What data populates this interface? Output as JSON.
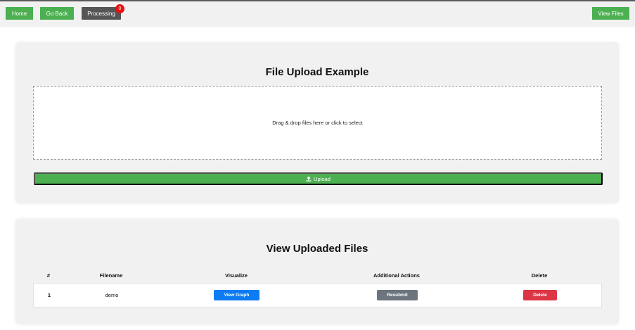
{
  "nav": {
    "home": "Home",
    "go_back": "Go Back",
    "processing": "Processing",
    "processing_count": "0",
    "view_files": "View Files"
  },
  "upload": {
    "title": "File Upload Example",
    "dropzone_text": "Drag & drop files here or click to select",
    "upload_label": "Upload",
    "upload_icon": "upload-icon"
  },
  "files": {
    "title": "View Uploaded Files",
    "columns": [
      "#",
      "Filename",
      "Visualize",
      "Additional Actions",
      "Delete"
    ],
    "rows": [
      {
        "index": "1",
        "filename": "demo",
        "visualize_label": "View Graph",
        "action_label": "Resubmit",
        "delete_label": "Delete"
      }
    ]
  },
  "colors": {
    "green": "#4caf50",
    "dark": "#555555",
    "badge": "#e81010",
    "blue": "#0d7bf2",
    "gray": "#6c757d",
    "red": "#dc3545"
  }
}
